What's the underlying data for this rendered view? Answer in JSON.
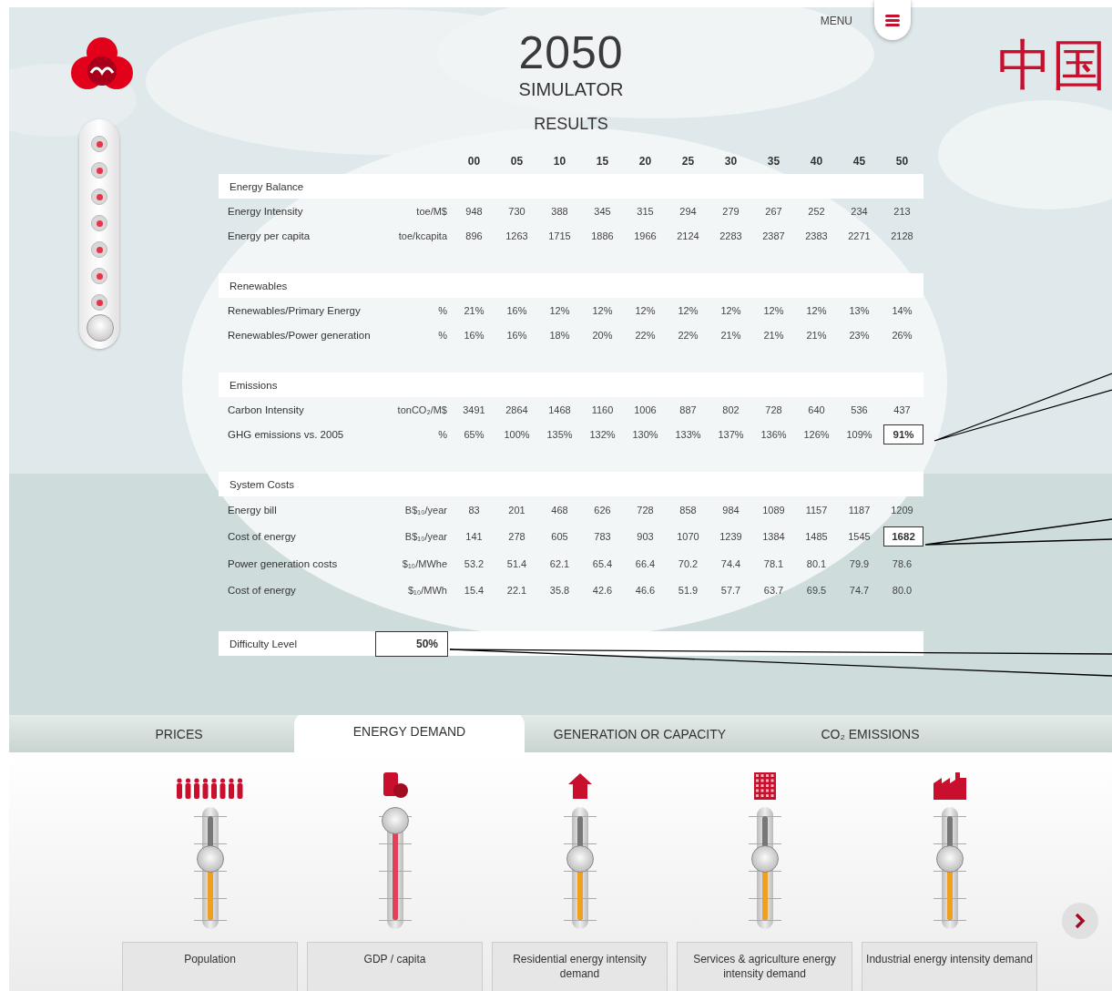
{
  "header": {
    "title": "2050",
    "subtitle": "SIMULATOR",
    "menu_label": "MENU",
    "country": "中国"
  },
  "difficulty_slider": {
    "level": 0
  },
  "results": {
    "title": "RESULTS",
    "years": [
      "00",
      "05",
      "10",
      "15",
      "20",
      "25",
      "30",
      "35",
      "40",
      "45",
      "50"
    ],
    "sections": [
      {
        "title": "Energy Balance",
        "rows": [
          {
            "label": "Energy Intensity",
            "unit": "toe/M$",
            "values": [
              "948",
              "730",
              "388",
              "345",
              "315",
              "294",
              "279",
              "267",
              "252",
              "234",
              "213"
            ],
            "boxed": false
          },
          {
            "label": "Energy per capita",
            "unit": "toe/kcapita",
            "values": [
              "896",
              "1263",
              "1715",
              "1886",
              "1966",
              "2124",
              "2283",
              "2387",
              "2383",
              "2271",
              "2128"
            ],
            "boxed": false
          }
        ]
      },
      {
        "title": "Renewables",
        "rows": [
          {
            "label": "Renewables/Primary Energy",
            "unit": "%",
            "values": [
              "21%",
              "16%",
              "12%",
              "12%",
              "12%",
              "12%",
              "12%",
              "12%",
              "12%",
              "13%",
              "14%"
            ],
            "boxed": false
          },
          {
            "label": "Renewables/Power generation",
            "unit": "%",
            "values": [
              "16%",
              "16%",
              "18%",
              "20%",
              "22%",
              "22%",
              "21%",
              "21%",
              "21%",
              "23%",
              "26%"
            ],
            "boxed": false
          }
        ]
      },
      {
        "title": "Emissions",
        "rows": [
          {
            "label": "Carbon Intensity",
            "unit": "tonCO₂/M$",
            "values": [
              "3491",
              "2864",
              "1468",
              "1160",
              "1006",
              "887",
              "802",
              "728",
              "640",
              "536",
              "437"
            ],
            "boxed": false
          },
          {
            "label": "GHG emissions vs. 2005",
            "unit": "%",
            "values": [
              "65%",
              "100%",
              "135%",
              "132%",
              "130%",
              "133%",
              "137%",
              "136%",
              "126%",
              "109%",
              "91%"
            ],
            "boxed": true
          }
        ]
      },
      {
        "title": "System Costs",
        "rows": [
          {
            "label": "Energy bill",
            "unit": "B$₁₀/year",
            "values": [
              "83",
              "201",
              "468",
              "626",
              "728",
              "858",
              "984",
              "1089",
              "1157",
              "1187",
              "1209"
            ],
            "boxed": false
          },
          {
            "label": "Cost of energy",
            "unit": "B$₁₀/year",
            "values": [
              "141",
              "278",
              "605",
              "783",
              "903",
              "1070",
              "1239",
              "1384",
              "1485",
              "1545",
              "1682"
            ],
            "boxed": true
          },
          {
            "label": "Power generation costs",
            "unit": "$₁₀/MWhe",
            "values": [
              "53.2",
              "51.4",
              "62.1",
              "65.4",
              "66.4",
              "70.2",
              "74.4",
              "78.1",
              "80.1",
              "79.9",
              "78.6"
            ],
            "boxed": false
          },
          {
            "label": "Cost of energy",
            "unit": "$₁₀/MWh",
            "values": [
              "15.4",
              "22.1",
              "35.8",
              "42.6",
              "46.6",
              "51.9",
              "57.7",
              "63.7",
              "69.5",
              "74.7",
              "80.0"
            ],
            "boxed": false
          }
        ]
      }
    ],
    "difficulty": {
      "label": "Difficulty Level",
      "value": "50%"
    }
  },
  "tabs": [
    {
      "label": "PRICES",
      "selected": false
    },
    {
      "label": "ENERGY DEMAND",
      "selected": true
    },
    {
      "label": "GENERATION OR CAPACITY",
      "selected": false
    },
    {
      "label": "CO₂ EMISSIONS",
      "selected": false
    }
  ],
  "sliders": [
    {
      "kind": "people",
      "label": "Population",
      "level": 0.6,
      "color": "#f0a020"
    },
    {
      "kind": "coins",
      "label": "GDP / capita",
      "level": 1,
      "color": "#e0405a"
    },
    {
      "kind": "house",
      "label": "Residential energy intensity demand",
      "level": 0.6,
      "color": "#f0a020"
    },
    {
      "kind": "building",
      "label": "Services & agriculture energy intensity demand",
      "level": 0.6,
      "color": "#f0a020"
    },
    {
      "kind": "factory",
      "label": "Industrial energy intensity demand",
      "level": 0.6,
      "color": "#f0a020"
    }
  ]
}
